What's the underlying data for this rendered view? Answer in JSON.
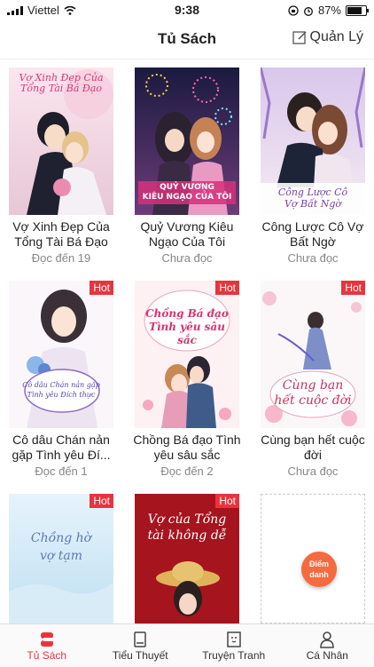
{
  "status_bar": {
    "carrier": "Viettel",
    "time": "9:38",
    "battery": "87%",
    "battery_fraction": 0.87
  },
  "header": {
    "title": "Tủ Sách",
    "manage_label": "Quản Lý"
  },
  "books": [
    {
      "title": "Vợ Xinh Đẹp Của Tổng Tài Bá Đạo",
      "status": "Đọc đến 19",
      "hot": "",
      "cover_text": "Vợ Xinh Đẹp Của\nTổng Tài Bá Đạo"
    },
    {
      "title": "Quỷ Vương Kiêu Ngạo Của Tôi",
      "status": "Chưa đọc",
      "hot": "",
      "cover_text": "QUỶ VƯƠNG\nKIÊU NGẠO CỦA TÔI"
    },
    {
      "title": "Công Lược Cô Vợ Bất Ngờ",
      "status": "Chưa đọc",
      "hot": "",
      "cover_text": "Công Lược Cô\nVợ Bất Ngờ"
    },
    {
      "title": "Cô dâu Chán nản gặp Tình yêu Đí...",
      "status": "Đọc đến 1",
      "hot": "Hot",
      "cover_text": "Cô dâu Chán nản gặp\nTình yêu Đích thực"
    },
    {
      "title": "Chồng Bá đạo Tình yêu sâu sắc",
      "status": "Đọc đến 2",
      "hot": "Hot",
      "cover_text": "Chồng Bá đạo\nTình yêu sâu sắc"
    },
    {
      "title": "Cùng bạn hết cuộc đời",
      "status": "Chưa đọc",
      "hot": "Hot",
      "cover_text": "Cùng bạn\nhết cuộc đời"
    },
    {
      "title": "",
      "status": "",
      "hot": "Hot",
      "cover_text": "Chồng hờ\nvợ tạm"
    },
    {
      "title": "",
      "status": "",
      "hot": "Hot",
      "cover_text": "Vợ của Tổng\ntài không dễ"
    }
  ],
  "checkin": {
    "label_line1": "Điểm",
    "label_line2": "danh"
  },
  "tabs": [
    {
      "label": "Tủ Sách",
      "icon": "bookshelf-icon",
      "active": true
    },
    {
      "label": "Tiểu Thuyết",
      "icon": "book-icon",
      "active": false
    },
    {
      "label": "Truyện Tranh",
      "icon": "comic-icon",
      "active": false
    },
    {
      "label": "Cá Nhân",
      "icon": "person-icon",
      "active": false
    }
  ],
  "colors": {
    "accent": "#e8343d",
    "checkin": "#f56a3e"
  }
}
